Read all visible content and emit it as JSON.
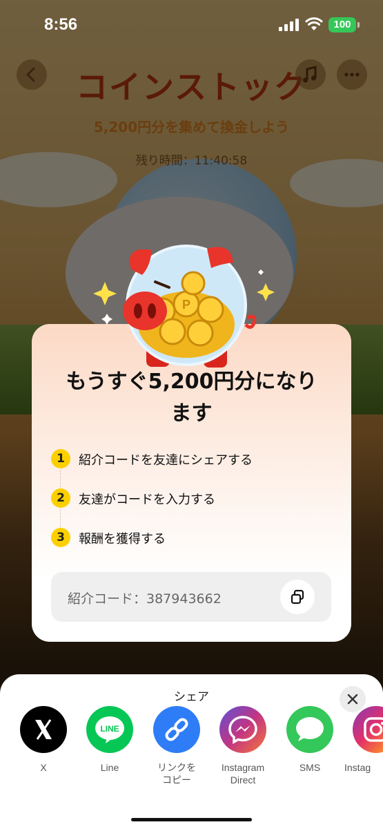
{
  "status_bar": {
    "time": "8:56",
    "battery": "100"
  },
  "game": {
    "title": "コインストック",
    "subtitle": "5,200円分を集めて換金しよう",
    "timer": "残り時間：11:40:58",
    "music_icon": "music-note-icon",
    "more_icon": "ellipsis-icon",
    "back_icon": "chevron-left-icon"
  },
  "modal": {
    "title": "もうすぐ5,200円分になり\nます",
    "steps": [
      {
        "number": "1",
        "text": "紹介コードを友達にシェアする"
      },
      {
        "number": "2",
        "text": "友達がコードを入力する"
      },
      {
        "number": "3",
        "text": "報酬を獲得する"
      }
    ],
    "referral_code": "紹介コード：387943662",
    "copy_icon": "copy-icon"
  },
  "share_sheet": {
    "title": "シェア",
    "items": [
      {
        "label": "X",
        "icon": "x-logo-icon",
        "color": "#000000"
      },
      {
        "label": "Line",
        "icon": "line-logo-icon",
        "color": "#06c755"
      },
      {
        "label": "リンクを\nコピー",
        "icon": "link-icon",
        "color": "#2f7df6"
      },
      {
        "label": "Instagram\nDirect",
        "icon": "messenger-icon",
        "color": "#c13584"
      },
      {
        "label": "SMS",
        "icon": "message-bubble-icon",
        "color": "#34c759"
      },
      {
        "label": "Instag",
        "icon": "instagram-icon",
        "color": "#e1306c"
      }
    ]
  },
  "colors": {
    "accent_yellow": "#fcd000",
    "overlay": "rgba(0,0,0,0.55)"
  }
}
